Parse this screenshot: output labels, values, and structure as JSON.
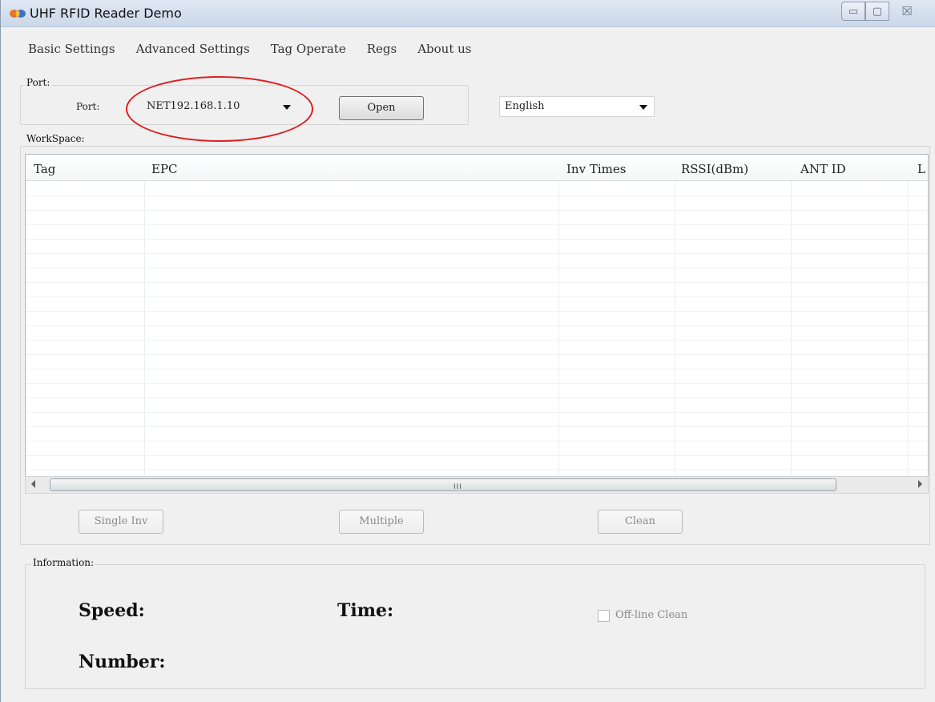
{
  "window": {
    "title": "UHF RFID Reader Demo",
    "controls": {
      "minimize": "▭",
      "maximize": "▢",
      "close": "☒"
    }
  },
  "menu": [
    "Basic Settings",
    "Advanced Settings",
    "Tag Operate",
    "Regs",
    "About us"
  ],
  "port_group": {
    "legend": "Port:",
    "port_label": "Port:",
    "port_value": "NET192.168.1.10",
    "open_label": "Open",
    "language_value": "English"
  },
  "workspace": {
    "legend": "WorkSpace:",
    "columns": [
      "Tag",
      "EPC",
      "Inv Times",
      "RSSI(dBm)",
      "ANT ID",
      "L"
    ],
    "rows": [],
    "scroll_grip": "III",
    "buttons": {
      "single": "Single Inv",
      "multiple": "Multiple",
      "clean": "Clean"
    }
  },
  "information": {
    "legend": "Information:",
    "speed_label": "Speed:",
    "time_label": "Time:",
    "number_label": "Number:",
    "offline_clean_label": "Off-line Clean",
    "offline_clean_checked": false
  },
  "annotation": {
    "color": "#e01e1e",
    "target": "port-combo"
  },
  "icons": {
    "app": "butterfly-logo-icon",
    "dropdown": "chevron-down-icon"
  }
}
